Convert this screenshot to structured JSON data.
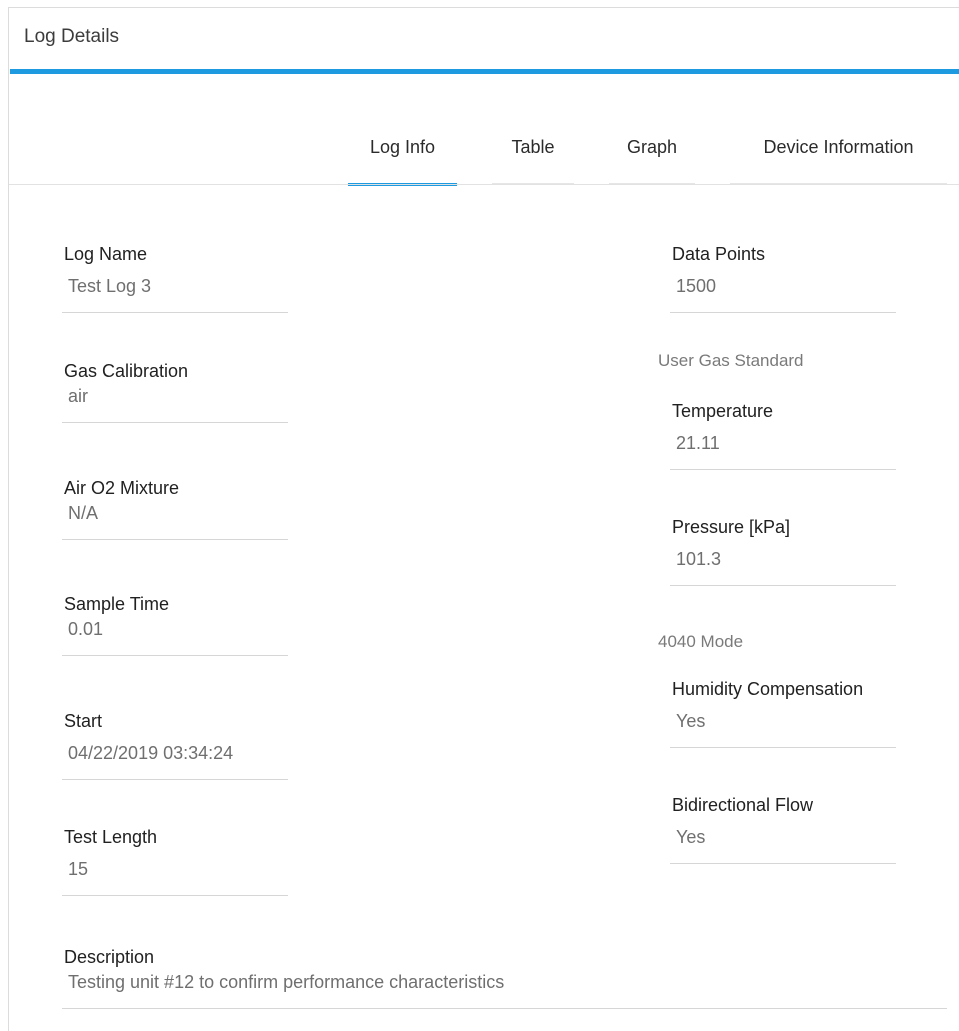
{
  "panel": {
    "title": "Log Details"
  },
  "tabs": [
    {
      "label": "Log Info",
      "active": true
    },
    {
      "label": "Table",
      "active": false
    },
    {
      "label": "Graph",
      "active": false
    },
    {
      "label": "Device Information",
      "active": false
    }
  ],
  "fields": {
    "log_name": {
      "label": "Log Name",
      "value": "Test Log 3"
    },
    "gas_calibration": {
      "label": "Gas Calibration",
      "value": "air"
    },
    "air_o2_mixture": {
      "label": "Air O2 Mixture",
      "value": "N/A"
    },
    "sample_time": {
      "label": "Sample Time",
      "value": "0.01"
    },
    "start": {
      "label": "Start",
      "value": "04/22/2019 03:34:24"
    },
    "test_length": {
      "label": "Test Length",
      "value": "15"
    },
    "description": {
      "label": "Description",
      "value": "Testing unit #12 to confirm performance characteristics"
    },
    "data_points": {
      "label": "Data Points",
      "value": "1500"
    },
    "temperature": {
      "label": "Temperature",
      "value": "21.11"
    },
    "pressure": {
      "label": "Pressure [kPa]",
      "value": "101.3"
    },
    "humidity_compensation": {
      "label": "Humidity Compensation",
      "value": "Yes"
    },
    "bidirectional_flow": {
      "label": "Bidirectional Flow",
      "value": "Yes"
    }
  },
  "sections": {
    "user_gas_standard": "User Gas Standard",
    "mode_4040": "4040 Mode"
  },
  "colors": {
    "accent": "#1e9ae0",
    "value_text": "#6f6f6f",
    "divider": "#d6d6d6"
  }
}
